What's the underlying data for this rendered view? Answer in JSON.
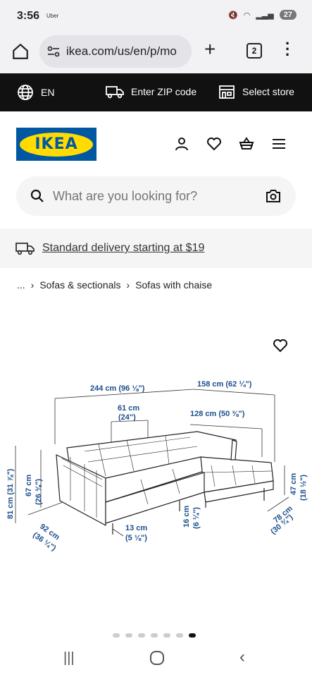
{
  "status": {
    "time": "3:56",
    "app": "Uber",
    "battery": "27"
  },
  "browser": {
    "url": "ikea.com/us/en/p/mo",
    "tab_count": "2"
  },
  "topbar": {
    "language": "EN",
    "zip": "Enter ZIP code",
    "store": "Select store"
  },
  "brand": {
    "logo_text": "IKEA"
  },
  "search": {
    "placeholder": "What are you looking for?"
  },
  "delivery": {
    "text": "Standard delivery starting at $19"
  },
  "breadcrumb": {
    "ellipsis": "...",
    "items": [
      "Sofas & sectionals",
      "Sofas with chaise"
    ]
  },
  "dimensions": {
    "total_width": "244 cm (96 ⅛\")",
    "chaise_length": "158 cm (62 ¼\")",
    "seat_depth": "61 cm",
    "seat_depth_in": "(24\")",
    "chaise_width": "128 cm (50 ⅜\")",
    "height_total": "81 cm (31 ⅞\")",
    "height_back": "67 cm",
    "height_back_in": "(26 ⅜\")",
    "depth": "92 cm",
    "depth_in": "(36 ¼\")",
    "leg_height": "13 cm",
    "leg_height_in": "(5 ⅛\")",
    "seat_height": "16 cm",
    "seat_height_in": "(6 ¼\")",
    "chaise_depth": "78 cm",
    "chaise_depth_in": "(30 ¾\")",
    "arm_height": "47 cm",
    "arm_height_in": "(18 ½\")"
  },
  "carousel": {
    "count": 7,
    "active_index": 6
  },
  "colors": {
    "ikea_blue": "#0058a3",
    "ikea_yellow": "#ffdb00",
    "dim_text": "#1b4f8c"
  }
}
